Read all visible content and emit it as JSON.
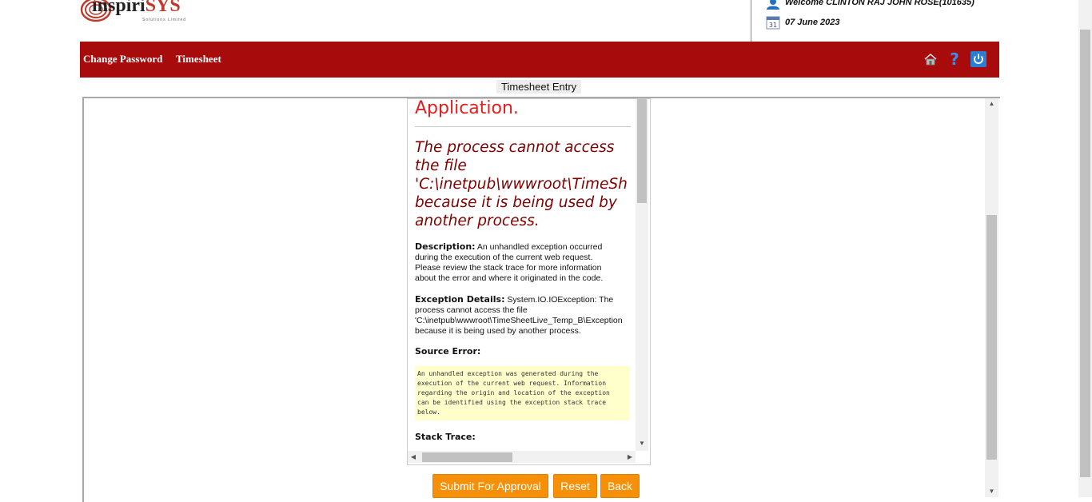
{
  "header": {
    "logo_main": "inspiri",
    "logo_accent": "SYS",
    "logo_sub": "Solutions Limited",
    "welcome_text": "Welcome CLINTON RAJ JOHN ROSE(101635)",
    "date_text": "07 June 2023",
    "calendar_day": "31"
  },
  "nav": {
    "change_password": "Change Password",
    "timesheet": "Timesheet",
    "icons": [
      "home-icon",
      "help-icon",
      "power-icon"
    ]
  },
  "page_title": "Timesheet Entry",
  "error_page": {
    "app_heading": "Application.",
    "title_lines": [
      "The process cannot access",
      "the file",
      "'C:\\inetpub\\wwwroot\\TimeSh",
      "because it is being used by",
      "another process."
    ],
    "description_label": "Description:",
    "description_lines": [
      "An unhandled exception occurred",
      "during the execution of the current web request.",
      "Please review the stack trace for more information",
      "about the error and where it originated in the code."
    ],
    "exception_label": "Exception Details:",
    "exception_lines": [
      "System.IO.IOException: The",
      "process cannot access the file",
      "'C:\\inetpub\\wwwroot\\TimeSheetLive_Temp_B\\Exception",
      "because it is being used by another process."
    ],
    "source_error_label": "Source Error:",
    "source_error_lines": [
      "An unhandled exception was generated during the",
      "execution of the current web request. Information",
      "regarding the origin and location of the exception",
      "can be identified using the exception stack trace",
      "below."
    ],
    "stack_trace_label": "Stack Trace:"
  },
  "buttons": {
    "submit": "Submit For Approval",
    "reset": "Reset",
    "back": "Back"
  },
  "colors": {
    "navbar": "#a80b0b",
    "button": "#f79009",
    "error_heading": "#e02020",
    "error_title": "#800000"
  }
}
